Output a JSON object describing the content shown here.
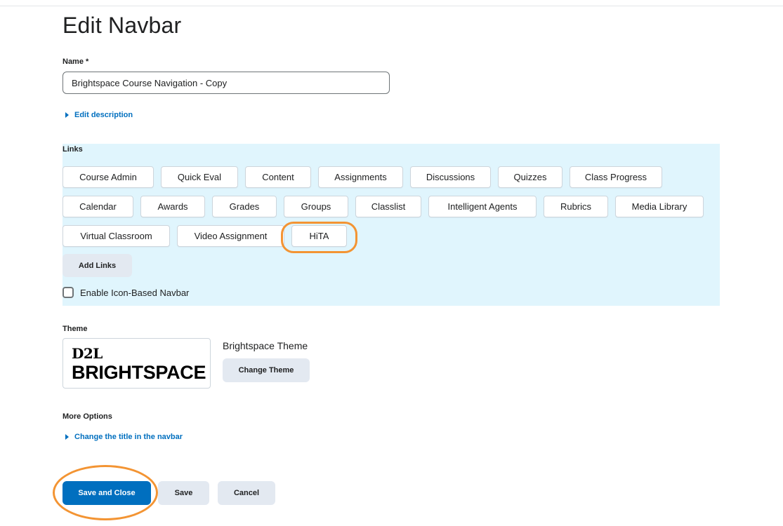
{
  "page": {
    "title": "Edit Navbar"
  },
  "name_field": {
    "label": "Name *",
    "value": "Brightspace Course Navigation - Copy"
  },
  "edit_description": {
    "label": "Edit description"
  },
  "links": {
    "label": "Links",
    "rows": [
      [
        "Course Admin",
        "Quick Eval",
        "Content",
        "Assignments",
        "Discussions",
        "Quizzes",
        "Class Progress"
      ],
      [
        "Calendar",
        "Awards",
        "Grades",
        "Groups",
        "Classlist",
        "Intelligent Agents",
        "Rubrics",
        "Media Library"
      ],
      [
        "Virtual Classroom",
        "Video Assignment",
        "HiTA"
      ]
    ],
    "add_button": "Add Links",
    "icon_navbar_checkbox": {
      "label": "Enable Icon-Based Navbar",
      "checked": false
    }
  },
  "theme": {
    "label": "Theme",
    "logo_top": "D2L",
    "logo_bottom": "BRIGHTSPACE",
    "name": "Brightspace Theme",
    "change_button": "Change Theme"
  },
  "more_options": {
    "label": "More Options",
    "change_title": "Change the title in the navbar"
  },
  "footer": {
    "save_close": "Save and Close",
    "save": "Save",
    "cancel": "Cancel"
  },
  "colors": {
    "accent": "#006fbf",
    "links_panel": "#e0f5fd",
    "highlight": "#f39433",
    "logo_accent": "#f39433"
  }
}
